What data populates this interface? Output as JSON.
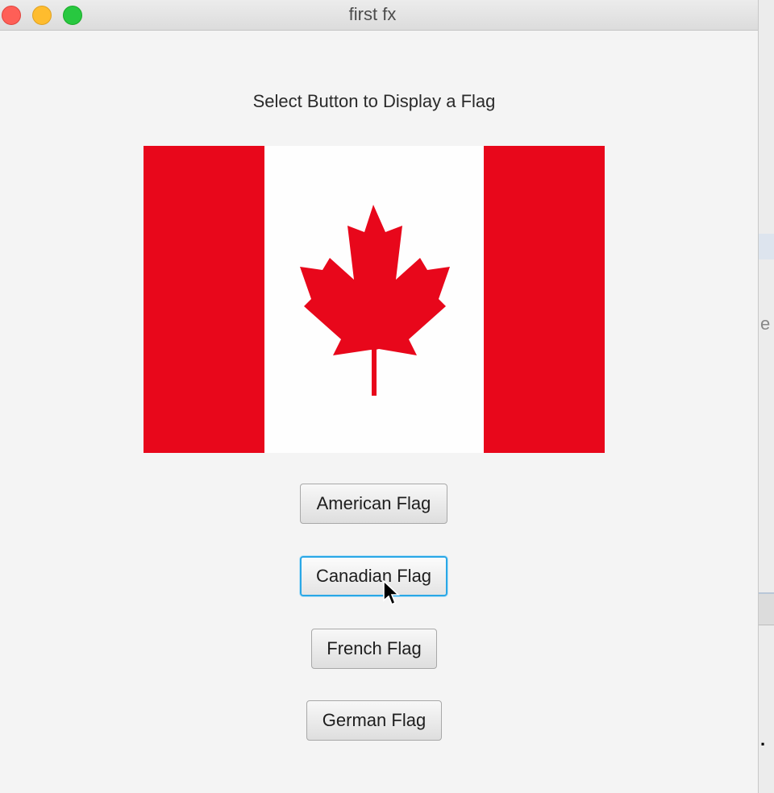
{
  "window": {
    "title": "first fx"
  },
  "prompt": "Select Button to Display a Flag",
  "flag": {
    "country": "Canada",
    "colors": {
      "red": "#e8071b",
      "white": "#fefefe"
    }
  },
  "buttons": {
    "american": "American Flag",
    "canadian": "Canadian Flag",
    "french": "French Flag",
    "german": "German Flag"
  },
  "focused_button": "canadian",
  "background_window": {
    "fragment_1": "e",
    "fragment_2": "."
  }
}
